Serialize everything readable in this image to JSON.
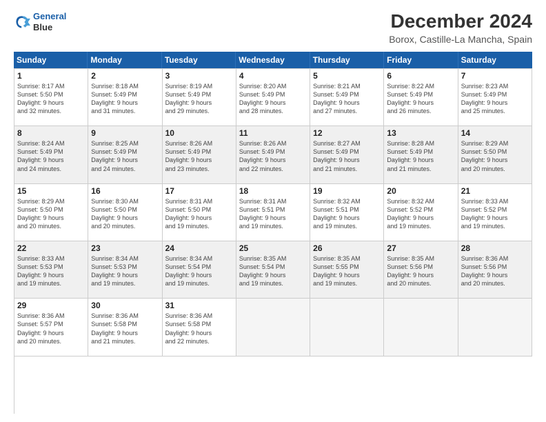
{
  "logo": {
    "line1": "General",
    "line2": "Blue"
  },
  "title": "December 2024",
  "subtitle": "Borox, Castille-La Mancha, Spain",
  "days_of_week": [
    "Sunday",
    "Monday",
    "Tuesday",
    "Wednesday",
    "Thursday",
    "Friday",
    "Saturday"
  ],
  "cells": [
    {
      "day": "",
      "empty": true
    },
    {
      "day": "",
      "empty": true
    },
    {
      "day": "",
      "empty": true
    },
    {
      "day": "",
      "empty": true
    },
    {
      "day": "",
      "empty": true
    },
    {
      "day": "",
      "empty": true
    },
    {
      "day": "",
      "empty": true
    },
    {
      "day": "1",
      "info": "Sunrise: 8:17 AM\nSunset: 5:50 PM\nDaylight: 9 hours and 32 minutes."
    },
    {
      "day": "2",
      "info": "Sunrise: 8:18 AM\nSunset: 5:49 PM\nDaylight: 9 hours and 31 minutes."
    },
    {
      "day": "3",
      "info": "Sunrise: 8:19 AM\nSunset: 5:49 PM\nDaylight: 9 hours and 29 minutes."
    },
    {
      "day": "4",
      "info": "Sunrise: 8:20 AM\nSunset: 5:49 PM\nDaylight: 9 hours and 28 minutes."
    },
    {
      "day": "5",
      "info": "Sunrise: 8:21 AM\nSunset: 5:49 PM\nDaylight: 9 hours and 27 minutes."
    },
    {
      "day": "6",
      "info": "Sunrise: 8:22 AM\nSunset: 5:49 PM\nDaylight: 9 hours and 26 minutes."
    },
    {
      "day": "7",
      "info": "Sunrise: 8:23 AM\nSunset: 5:49 PM\nDaylight: 9 hours and 25 minutes."
    },
    {
      "day": "8",
      "info": "Sunrise: 8:24 AM\nSunset: 5:49 PM\nDaylight: 9 hours and 24 minutes."
    },
    {
      "day": "9",
      "info": "Sunrise: 8:25 AM\nSunset: 5:49 PM\nDaylight: 9 hours and 24 minutes."
    },
    {
      "day": "10",
      "info": "Sunrise: 8:26 AM\nSunset: 5:49 PM\nDaylight: 9 hours and 23 minutes."
    },
    {
      "day": "11",
      "info": "Sunrise: 8:26 AM\nSunset: 5:49 PM\nDaylight: 9 hours and 22 minutes."
    },
    {
      "day": "12",
      "info": "Sunrise: 8:27 AM\nSunset: 5:49 PM\nDaylight: 9 hours and 21 minutes."
    },
    {
      "day": "13",
      "info": "Sunrise: 8:28 AM\nSunset: 5:49 PM\nDaylight: 9 hours and 21 minutes."
    },
    {
      "day": "14",
      "info": "Sunrise: 8:29 AM\nSunset: 5:50 PM\nDaylight: 9 hours and 20 minutes."
    },
    {
      "day": "15",
      "info": "Sunrise: 8:29 AM\nSunset: 5:50 PM\nDaylight: 9 hours and 20 minutes."
    },
    {
      "day": "16",
      "info": "Sunrise: 8:30 AM\nSunset: 5:50 PM\nDaylight: 9 hours and 20 minutes."
    },
    {
      "day": "17",
      "info": "Sunrise: 8:31 AM\nSunset: 5:50 PM\nDaylight: 9 hours and 19 minutes."
    },
    {
      "day": "18",
      "info": "Sunrise: 8:31 AM\nSunset: 5:51 PM\nDaylight: 9 hours and 19 minutes."
    },
    {
      "day": "19",
      "info": "Sunrise: 8:32 AM\nSunset: 5:51 PM\nDaylight: 9 hours and 19 minutes."
    },
    {
      "day": "20",
      "info": "Sunrise: 8:32 AM\nSunset: 5:52 PM\nDaylight: 9 hours and 19 minutes."
    },
    {
      "day": "21",
      "info": "Sunrise: 8:33 AM\nSunset: 5:52 PM\nDaylight: 9 hours and 19 minutes."
    },
    {
      "day": "22",
      "info": "Sunrise: 8:33 AM\nSunset: 5:53 PM\nDaylight: 9 hours and 19 minutes."
    },
    {
      "day": "23",
      "info": "Sunrise: 8:34 AM\nSunset: 5:53 PM\nDaylight: 9 hours and 19 minutes."
    },
    {
      "day": "24",
      "info": "Sunrise: 8:34 AM\nSunset: 5:54 PM\nDaylight: 9 hours and 19 minutes."
    },
    {
      "day": "25",
      "info": "Sunrise: 8:35 AM\nSunset: 5:54 PM\nDaylight: 9 hours and 19 minutes."
    },
    {
      "day": "26",
      "info": "Sunrise: 8:35 AM\nSunset: 5:55 PM\nDaylight: 9 hours and 19 minutes."
    },
    {
      "day": "27",
      "info": "Sunrise: 8:35 AM\nSunset: 5:56 PM\nDaylight: 9 hours and 20 minutes."
    },
    {
      "day": "28",
      "info": "Sunrise: 8:36 AM\nSunset: 5:56 PM\nDaylight: 9 hours and 20 minutes."
    },
    {
      "day": "29",
      "info": "Sunrise: 8:36 AM\nSunset: 5:57 PM\nDaylight: 9 hours and 20 minutes."
    },
    {
      "day": "30",
      "info": "Sunrise: 8:36 AM\nSunset: 5:58 PM\nDaylight: 9 hours and 21 minutes."
    },
    {
      "day": "31",
      "info": "Sunrise: 8:36 AM\nSunset: 5:58 PM\nDaylight: 9 hours and 22 minutes."
    },
    {
      "day": "",
      "empty": true
    },
    {
      "day": "",
      "empty": true
    },
    {
      "day": "",
      "empty": true
    },
    {
      "day": "",
      "empty": true
    },
    {
      "day": "",
      "empty": true
    }
  ]
}
